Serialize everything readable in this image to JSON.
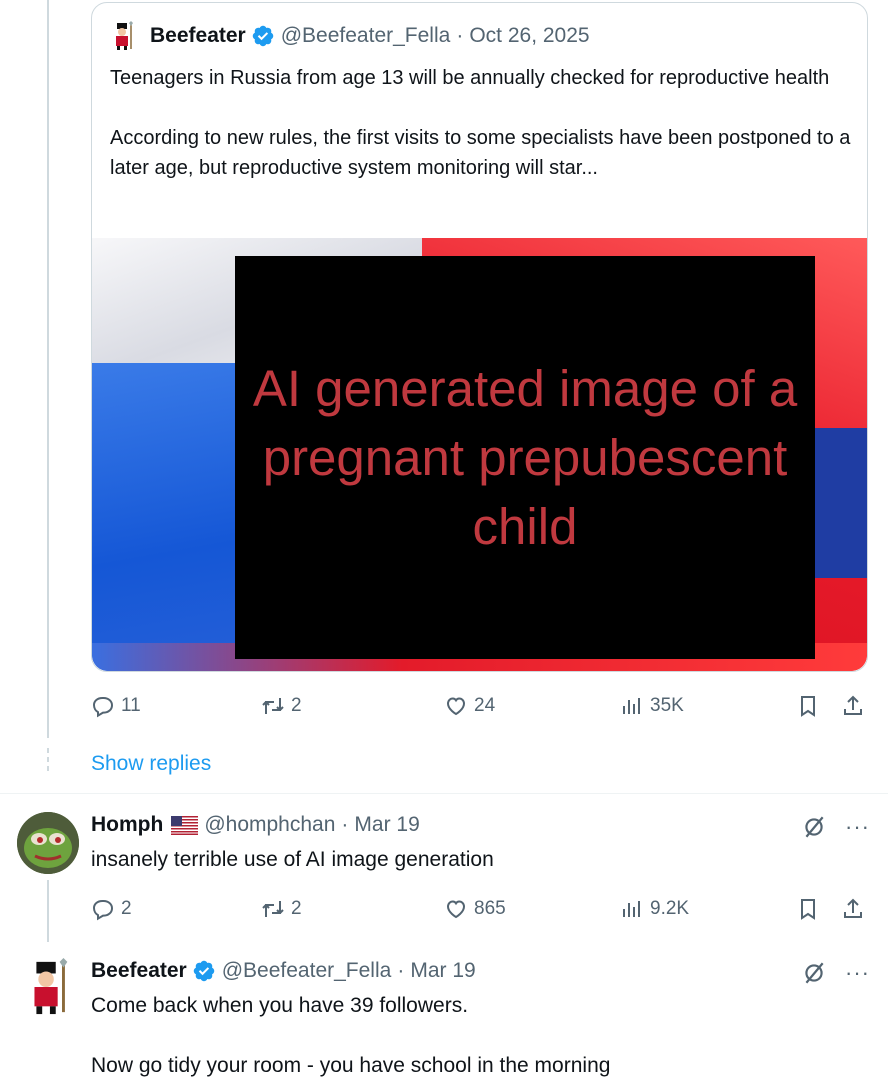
{
  "quoted_tweet": {
    "author_name": "Beefeater",
    "author_handle": "@Beefeater_Fella",
    "separator": "·",
    "date": "Oct 26, 2025",
    "text_para1": "Teenagers in Russia from age 13 will be annually checked for reproductive health",
    "text_para2": "According to new rules, the first visits to some specialists have been postponed to a later age, but reproductive system monitoring will star...",
    "overlay_text": "AI generated image of a pregnant prepubescent child",
    "actions": {
      "replies": "11",
      "reposts": "2",
      "likes": "24",
      "views": "35K"
    }
  },
  "show_replies_label": "Show replies",
  "reply_1": {
    "author_name": "Homph",
    "author_handle": "@homphchan",
    "separator": "·",
    "date": "Mar 19",
    "text": "insanely terrible use of AI image generation",
    "more_label": "···",
    "actions": {
      "replies": "2",
      "reposts": "2",
      "likes": "865",
      "views": "9.2K"
    }
  },
  "reply_2": {
    "author_name": "Beefeater",
    "author_handle": "@Beefeater_Fella",
    "separator": "·",
    "date": "Mar 19",
    "text_para1": "Come back when you have 39 followers.",
    "text_para2": "Now go tidy your room - you have school in the morning",
    "more_label": "···"
  },
  "colors": {
    "accent": "#1d9bf0",
    "muted": "#536471",
    "overlay_text": "#c0393f",
    "verified": "#1d9bf0"
  },
  "icons": [
    "reply-icon",
    "repost-icon",
    "like-icon",
    "views-icon",
    "bookmark-icon",
    "share-icon",
    "grok-icon",
    "more-icon",
    "verified-badge-icon",
    "us-flag-icon"
  ]
}
